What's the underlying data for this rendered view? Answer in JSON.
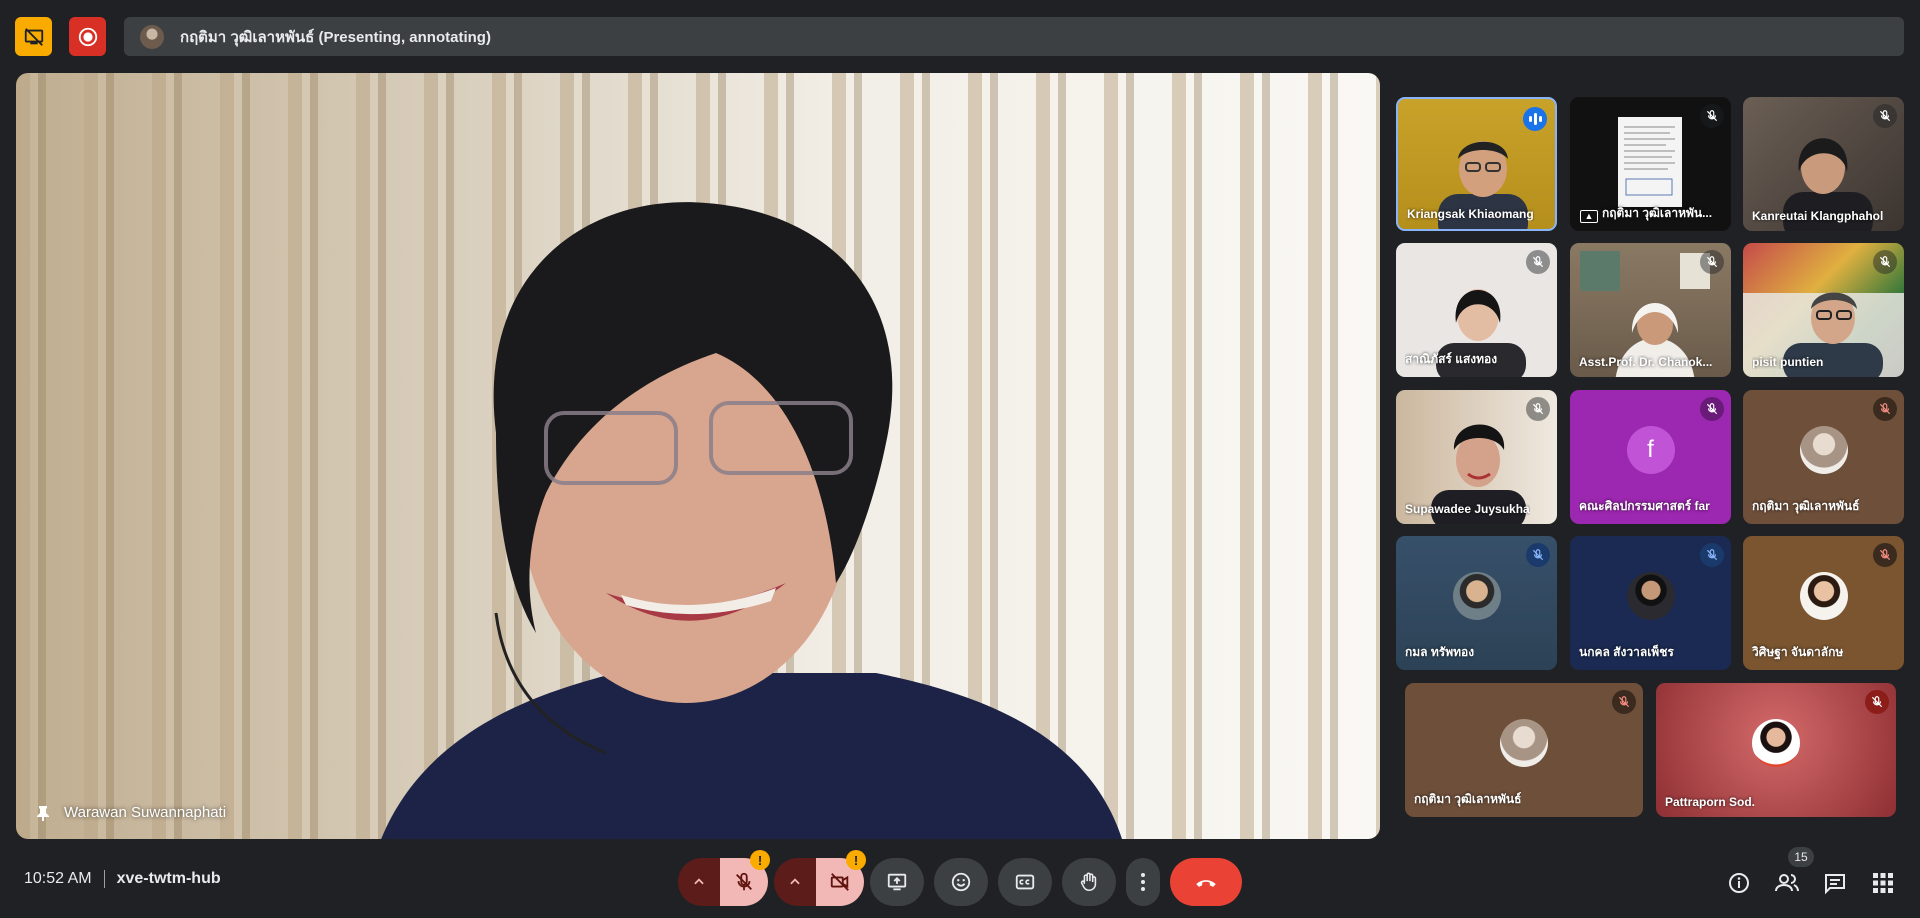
{
  "presenting": {
    "label": "กฤติมา วุฒิเลาหพันธ์ (Presenting, annotating)"
  },
  "main_speaker": {
    "name": "Warawan Suwannaphati"
  },
  "participants": [
    {
      "name": "Kriangsak Khiaomang",
      "state": "speaking"
    },
    {
      "name": "กฤติมา วุฒิเลาหพัน...",
      "state": "presenting"
    },
    {
      "name": "Kanreutai Klangphahol",
      "state": "muted"
    },
    {
      "name": "สาณิภัสร์ แสงทอง",
      "state": "muted"
    },
    {
      "name": "Asst.Prof. Dr. Chanok...",
      "state": "muted"
    },
    {
      "name": "pisit puntien",
      "state": "muted"
    },
    {
      "name": "Supawadee Juysukha",
      "state": "muted"
    },
    {
      "name": "คณะศิลปกรรมศาสตร์ far",
      "state": "muted",
      "initial": "f"
    },
    {
      "name": "กฤติมา วุฒิเลาหพันธ์",
      "state": "muted"
    },
    {
      "name": "กมล ทรัพทอง",
      "state": "muted"
    },
    {
      "name": "นกคล สังวาลเพ็ชร",
      "state": "muted"
    },
    {
      "name": "วิศิษฐา จันดาลักษ",
      "state": "muted"
    },
    {
      "name": "กฤติมา วุฒิเลาหพันธ์",
      "state": "muted"
    },
    {
      "name": "Pattraporn Sod.",
      "state": "muted"
    }
  ],
  "footer": {
    "time": "10:52 AM",
    "meeting_code": "xve-twtm-hub",
    "warn_mark": "!",
    "people_count": "15"
  },
  "colors": {
    "end_call": "#ea4335",
    "hide_button": "#f9ab00",
    "record_button": "#d93025",
    "muted_control": "#f2b8b5"
  },
  "icons": [
    "hide-presenting-icon",
    "record-icon",
    "pin-icon",
    "mic-off-icon",
    "camera-off-icon",
    "present-icon",
    "emoji-icon",
    "captions-icon",
    "raise-hand-icon",
    "more-options-icon",
    "end-call-icon",
    "info-icon",
    "people-icon",
    "chat-icon",
    "activities-icon"
  ]
}
